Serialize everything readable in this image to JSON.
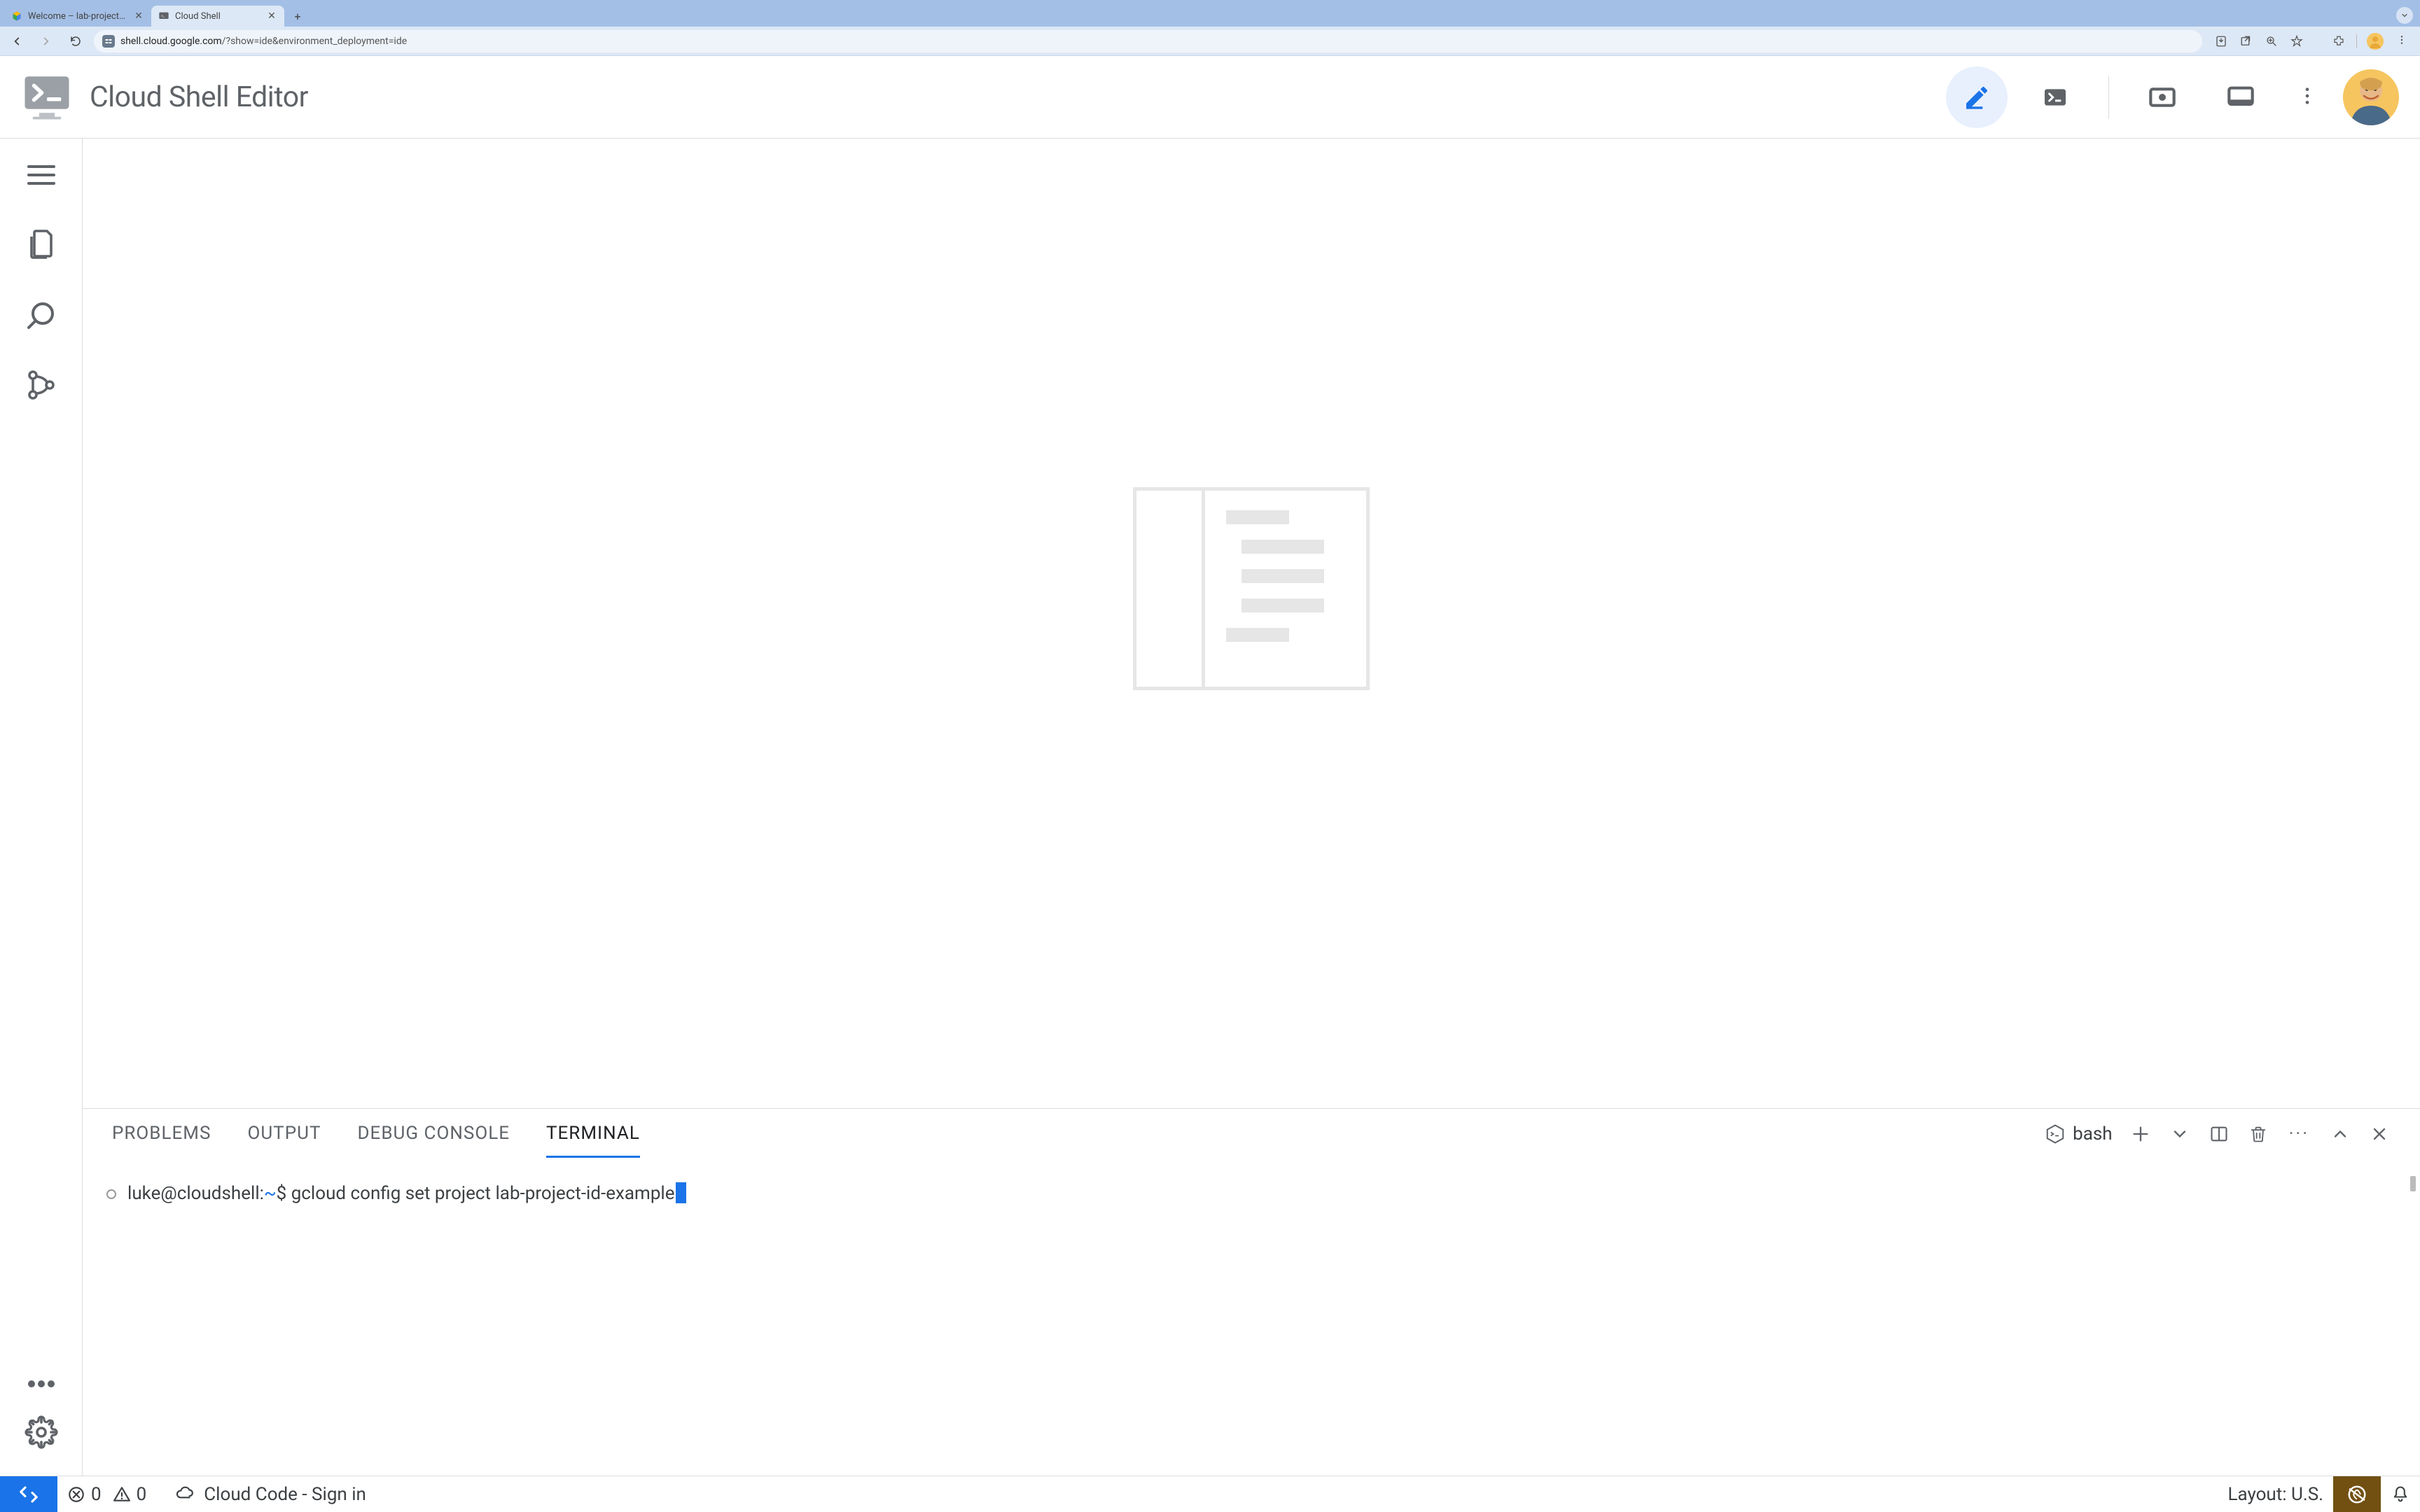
{
  "browser": {
    "tabs": [
      {
        "title": "Welcome – lab-project-id-ex…",
        "active": false
      },
      {
        "title": "Cloud Shell",
        "active": true
      }
    ],
    "url_domain": "shell.cloud.google.com",
    "url_path": "/?show=ide&environment_deployment=ide"
  },
  "header": {
    "title": "Cloud Shell Editor"
  },
  "panel": {
    "tabs": [
      "PROBLEMS",
      "OUTPUT",
      "DEBUG CONSOLE",
      "TERMINAL"
    ],
    "active_tab": "TERMINAL",
    "shell_name": "bash"
  },
  "terminal": {
    "prompt_user": "luke@cloudshell",
    "prompt_sep": ":",
    "prompt_path": "~",
    "prompt_symbol": "$",
    "command": "gcloud config set project lab-project-id-example"
  },
  "status": {
    "errors": "0",
    "warnings": "0",
    "cloud_code": "Cloud Code - Sign in",
    "layout": "Layout: U.S."
  }
}
